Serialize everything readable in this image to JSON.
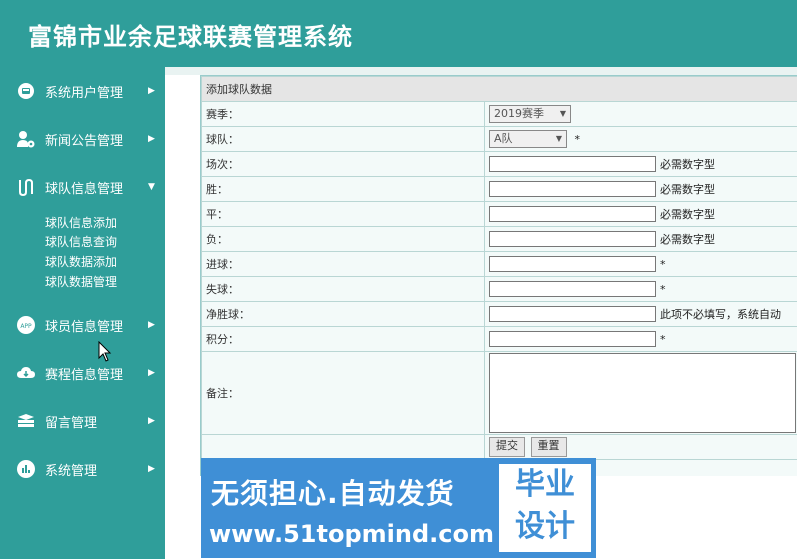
{
  "header": {
    "title": "富锦市业余足球联赛管理系统"
  },
  "sidebar": {
    "items": [
      {
        "label": "系统用户管理",
        "icon": "user-badge-icon"
      },
      {
        "label": "新闻公告管理",
        "icon": "user-gear-icon"
      },
      {
        "label": "球队信息管理",
        "icon": "route-icon",
        "submenu": [
          "球队信息添加",
          "球队信息查询",
          "球队数据添加",
          "球队数据管理"
        ]
      },
      {
        "label": "球员信息管理",
        "icon": "app-icon"
      },
      {
        "label": "赛程信息管理",
        "icon": "cloud-icon"
      },
      {
        "label": "留言管理",
        "icon": "layers-icon"
      },
      {
        "label": "系统管理",
        "icon": "chart-icon"
      }
    ]
  },
  "form": {
    "caption": "添加球队数据",
    "season": {
      "label": "赛季：",
      "value": "2019赛季"
    },
    "team": {
      "label": "球队：",
      "value": "A队",
      "hint": "*"
    },
    "rows": [
      {
        "label": "场次：",
        "hint": "必需数字型"
      },
      {
        "label": "胜：",
        "hint": "必需数字型"
      },
      {
        "label": "平：",
        "hint": "必需数字型"
      },
      {
        "label": "负：",
        "hint": "必需数字型"
      },
      {
        "label": "进球：",
        "hint": "*"
      },
      {
        "label": "失球：",
        "hint": "*"
      },
      {
        "label": "净胜球：",
        "hint": "此项不必填写，系统自动"
      },
      {
        "label": "积分：",
        "hint": "*"
      }
    ],
    "note": {
      "label": "备注："
    },
    "buttons": {
      "submit": "提交",
      "reset": "重置"
    }
  },
  "watermark": {
    "line1": "无须担心.自动发货",
    "line2": "www.51topmind.com",
    "box_line1": "毕业",
    "box_line2": "设计"
  }
}
